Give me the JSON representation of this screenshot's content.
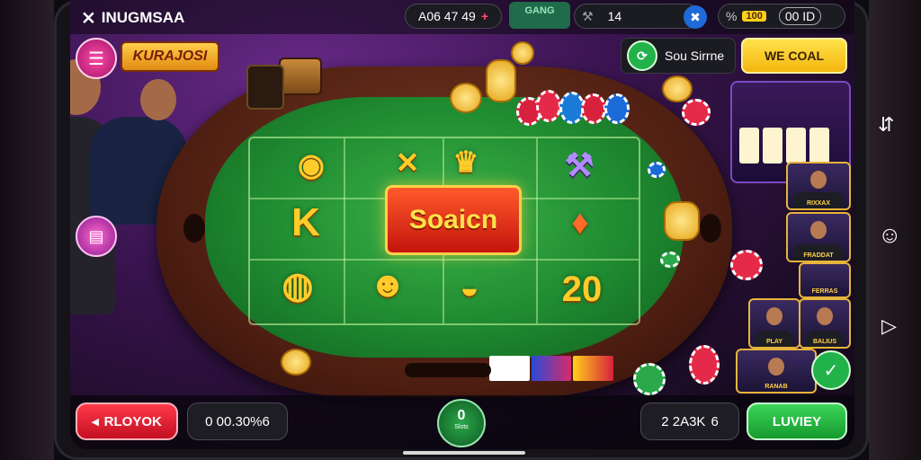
{
  "topbar": {
    "brand": "INUGMSAA",
    "balance": "A06 47 49",
    "balance_add": "+",
    "green_tab": "GANG",
    "level_value": "14",
    "bonus_tag": "100",
    "right_counter": "00 ID",
    "x_label": "%"
  },
  "left_hud": {
    "game_logo": "KURAJOSI"
  },
  "table": {
    "center_banner": "Soaicn",
    "symbols": [
      "K",
      "20"
    ]
  },
  "right_panel": {
    "status_label": "Sou Sirrne",
    "cta_label": "WE COAL",
    "thumbnails": [
      {
        "caption": "RIXXAX"
      },
      {
        "caption": "FRADDAT"
      },
      {
        "caption": "FERRAS"
      },
      {
        "caption": "PLAY"
      },
      {
        "caption": "BALIUS"
      },
      {
        "caption": "RANAB"
      }
    ]
  },
  "bottombar": {
    "left_btn": "RLOYOK",
    "pot_value": "0 00.30%6",
    "center_label": "0",
    "center_sub": "Slots",
    "bet_value": "2 2A3K",
    "bet_suffix": "6",
    "action_btn": "LUVIEY"
  },
  "colors": {
    "felt": "#2a9a3c",
    "rim": "#5a2414",
    "accent_pink": "#e0137a",
    "accent_yellow": "#ffcf1a",
    "action_green": "#21a83a",
    "danger_red": "#d6132c"
  }
}
